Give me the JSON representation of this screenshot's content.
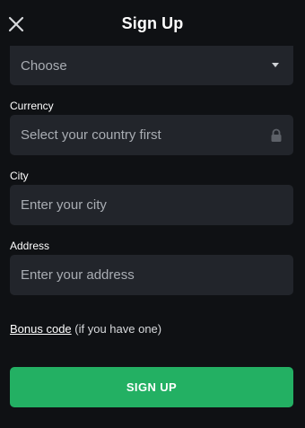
{
  "header": {
    "title": "Sign Up"
  },
  "country": {
    "value": "Choose"
  },
  "currency": {
    "label": "Currency",
    "placeholder": "Select your country first"
  },
  "city": {
    "label": "City",
    "placeholder": "Enter your city"
  },
  "address": {
    "label": "Address",
    "placeholder": "Enter your address"
  },
  "bonus": {
    "link_text": "Bonus code",
    "note": " (if you have one)"
  },
  "submit": {
    "label": "SIGN UP"
  },
  "colors": {
    "background": "#0f1114",
    "field": "#22252b",
    "accent": "#23b063"
  },
  "icons": [
    "close-icon",
    "chevron-down-icon",
    "lock-icon"
  ]
}
